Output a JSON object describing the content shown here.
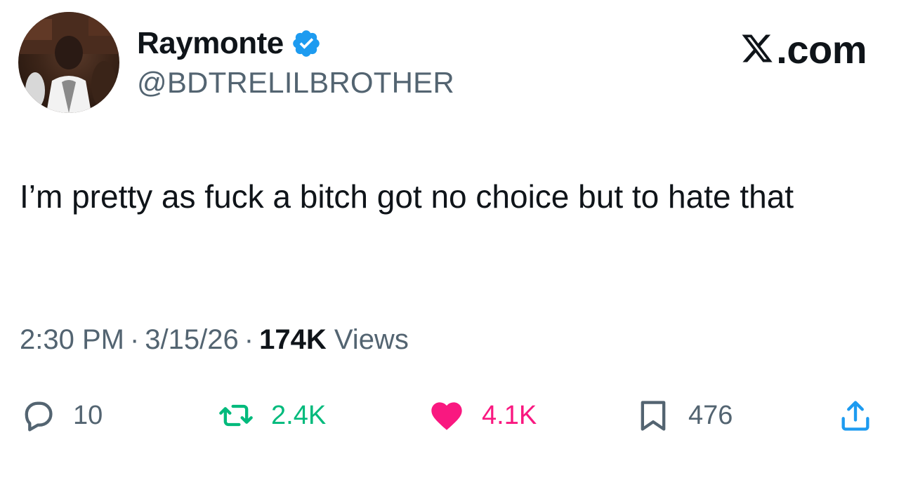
{
  "author": {
    "display_name": "Raymonte",
    "handle": "@BDTRELILBROTHER",
    "verified_icon": "verified-badge-icon"
  },
  "brand": {
    "label": ".com",
    "icon": "x-logo-icon"
  },
  "tweet": {
    "text": "I’m pretty as fuck a bitch got no choice but to hate that"
  },
  "meta": {
    "time": "2:30 PM",
    "separator": "·",
    "date": "3/15/26",
    "views_count": "174K",
    "views_label": "Views"
  },
  "actions": {
    "reply": {
      "icon": "reply-icon",
      "count": "10"
    },
    "retweet": {
      "icon": "retweet-icon",
      "count": "2.4K"
    },
    "like": {
      "icon": "heart-icon",
      "count": "4.1K"
    },
    "bookmark": {
      "icon": "bookmark-icon",
      "count": "476"
    },
    "share": {
      "icon": "share-icon"
    }
  },
  "colors": {
    "verified": "#1d9bf0",
    "retweet": "#00ba7c",
    "like": "#f91880",
    "secondary_text": "#536471",
    "primary_text": "#0f1419"
  }
}
